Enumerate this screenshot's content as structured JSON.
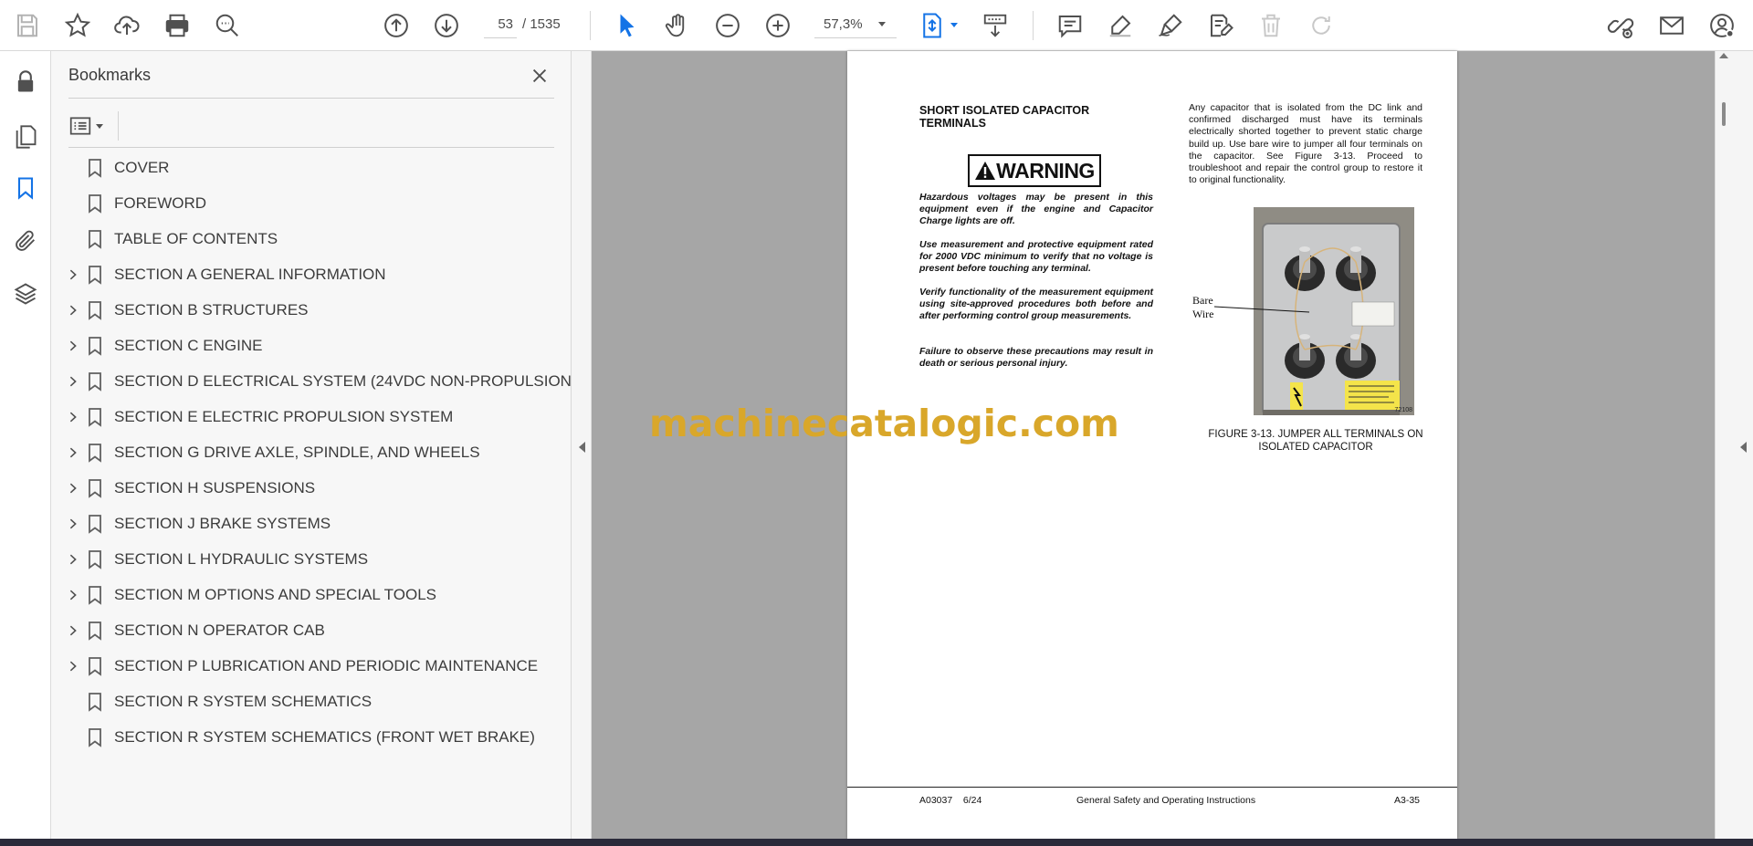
{
  "toolbar": {
    "page_current": "53",
    "page_total": "/ 1535",
    "zoom": "57,3%",
    "accent_color": "#1473e6"
  },
  "bookmarks": {
    "title": "Bookmarks",
    "items": [
      {
        "label": "COVER",
        "expandable": false
      },
      {
        "label": "FOREWORD",
        "expandable": false
      },
      {
        "label": "TABLE OF CONTENTS",
        "expandable": false
      },
      {
        "label": "SECTION A GENERAL INFORMATION",
        "expandable": true
      },
      {
        "label": "SECTION B STRUCTURES",
        "expandable": true
      },
      {
        "label": "SECTION C ENGINE",
        "expandable": true
      },
      {
        "label": "SECTION D ELECTRICAL SYSTEM (24VDC NON-PROPULSION)",
        "expandable": true
      },
      {
        "label": "SECTION E ELECTRIC PROPULSION SYSTEM",
        "expandable": true
      },
      {
        "label": "SECTION G DRIVE AXLE, SPINDLE, AND WHEELS",
        "expandable": true
      },
      {
        "label": "SECTION H SUSPENSIONS",
        "expandable": true
      },
      {
        "label": "SECTION J BRAKE SYSTEMS",
        "expandable": true
      },
      {
        "label": "SECTION L HYDRAULIC SYSTEMS",
        "expandable": true
      },
      {
        "label": "SECTION M OPTIONS AND SPECIAL TOOLS",
        "expandable": true
      },
      {
        "label": "SECTION N OPERATOR CAB",
        "expandable": true
      },
      {
        "label": "SECTION P LUBRICATION AND PERIODIC MAINTENANCE",
        "expandable": true
      },
      {
        "label": "SECTION R SYSTEM SCHEMATICS",
        "expandable": false
      },
      {
        "label": "SECTION R SYSTEM SCHEMATICS (FRONT WET BRAKE)",
        "expandable": false
      }
    ]
  },
  "page": {
    "section_title": "SHORT ISOLATED CAPACITOR TERMINALS",
    "warning_label": "WARNING",
    "warning_paragraphs": [
      "Hazardous voltages may be present in this equipment even if the engine and Capacitor Charge lights are off.",
      "Use measurement and protective equipment rated for 2000 VDC minimum to verify that no voltage is present before touching any terminal.",
      "Verify functionality of the measurement equipment using site-approved procedures both before and after performing control group measurements.",
      "Failure to observe these precautions may result in death or serious personal injury."
    ],
    "right_paragraph": "Any capacitor that is isolated from the DC link and confirmed discharged must have its terminals electrically shorted together to prevent static charge build up. Use bare wire to jumper all four terminals on the capacitor. See Figure 3-13. Proceed to troubleshoot and repair the control group to restore it to original functionality.",
    "callout_line1": "Bare",
    "callout_line2": "Wire",
    "photo_id": "72108",
    "figure_caption": "FIGURE 3-13. JUMPER ALL TERMINALS ON ISOLATED CAPACITOR",
    "footer_doc": "A03037    6/24",
    "footer_title": "General Safety and Operating Instructions",
    "footer_page": "A3-35"
  },
  "watermark": "machinecatalogic.com"
}
